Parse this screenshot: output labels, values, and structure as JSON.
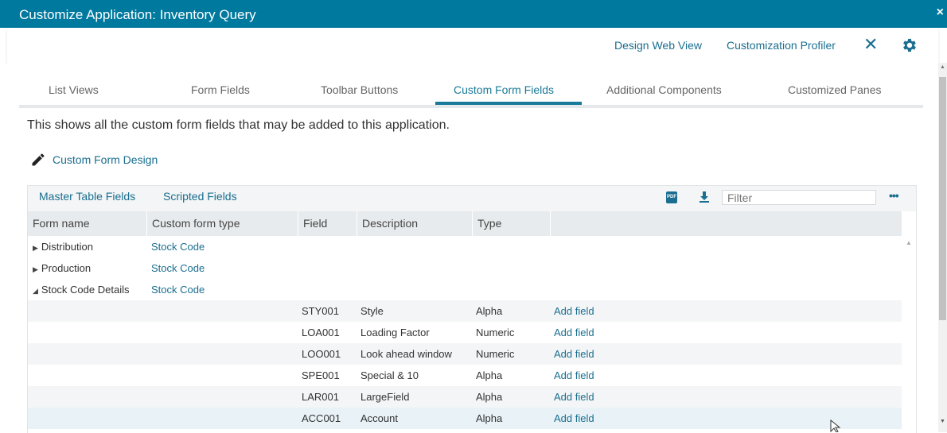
{
  "window": {
    "title": "Customize Application: Inventory Query",
    "close_glyph": "×"
  },
  "header": {
    "links": [
      "Design Web View",
      "Customization Profiler"
    ],
    "close_icon": "close-icon",
    "settings_icon": "gear-icon"
  },
  "tabs": [
    {
      "label": "List Views",
      "active": false
    },
    {
      "label": "Form Fields",
      "active": false
    },
    {
      "label": "Toolbar Buttons",
      "active": false
    },
    {
      "label": "Custom Form Fields",
      "active": true
    },
    {
      "label": "Additional Components",
      "active": false
    },
    {
      "label": "Customized Panes",
      "active": false
    }
  ],
  "description": "This shows all the custom form fields that may be added to this application.",
  "custom_form_design": {
    "label": "Custom Form Design",
    "icon": "pencil-icon"
  },
  "grid": {
    "subtabs": [
      "Master Table Fields",
      "Scripted Fields"
    ],
    "filter_placeholder": "Filter",
    "more_glyph": "•••",
    "pdf_label": "PDF",
    "columns": [
      "Form name",
      "Custom form type",
      "Field",
      "Description",
      "Type"
    ],
    "groups": [
      {
        "form_name": "Distribution",
        "expanded": false,
        "type": "Stock Code"
      },
      {
        "form_name": "Production",
        "expanded": false,
        "type": "Stock Code"
      },
      {
        "form_name": "Stock Code Details",
        "expanded": true,
        "type": "Stock Code"
      }
    ],
    "collapsed_glyph": "▶",
    "expanded_glyph": "◢",
    "rows": [
      {
        "field": "STY001",
        "description": "Style",
        "type": "Alpha",
        "action": "Add field"
      },
      {
        "field": "LOA001",
        "description": "Loading Factor",
        "type": "Numeric",
        "action": "Add field"
      },
      {
        "field": "LOO001",
        "description": "Look ahead window",
        "type": "Numeric",
        "action": "Add field"
      },
      {
        "field": "SPE001",
        "description": "Special & 10",
        "type": "Alpha",
        "action": "Add field"
      },
      {
        "field": "LAR001",
        "description": "LargeField",
        "type": "Alpha",
        "action": "Add field"
      },
      {
        "field": "ACC001",
        "description": "Account",
        "type": "Alpha",
        "action": "Add field"
      }
    ]
  },
  "colors": {
    "titlebar": "#00799e",
    "accent": "#1a6e8f"
  }
}
